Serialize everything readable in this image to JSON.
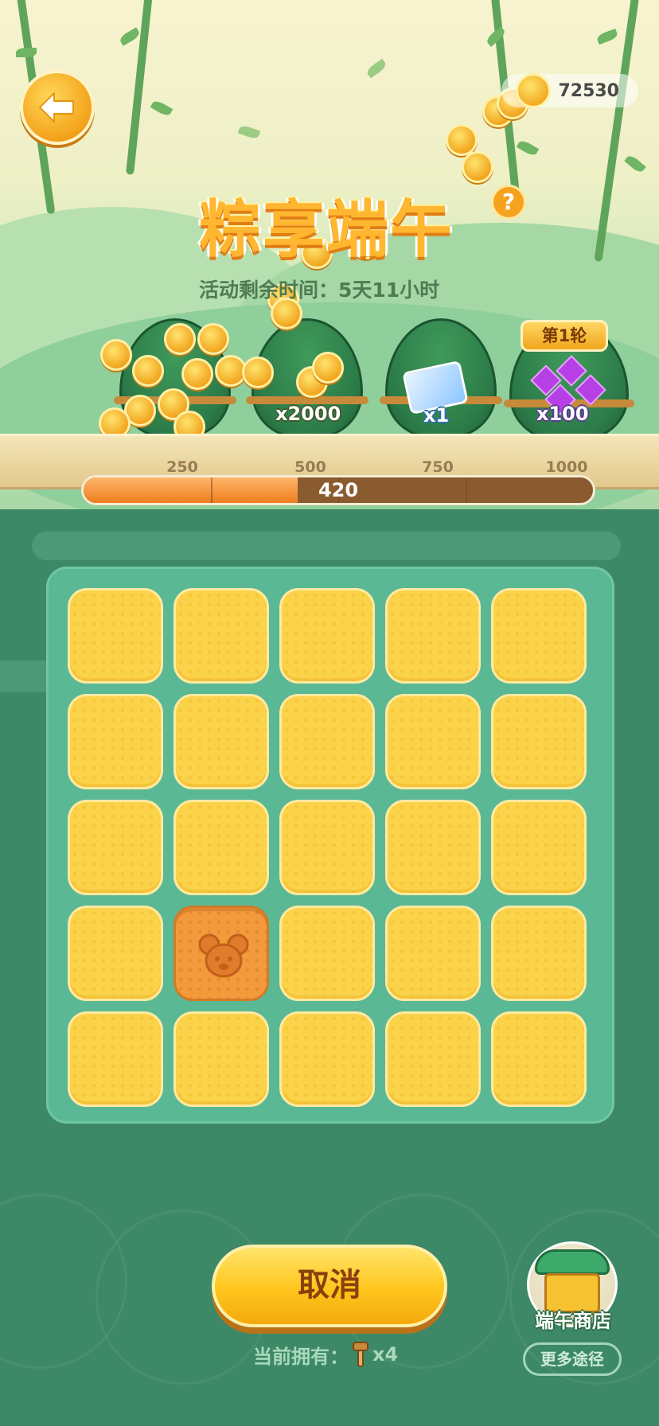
{
  "header": {
    "coin_balance": "72530",
    "event_title": "粽享端午",
    "help_label": "?",
    "time_left_text": "活动剩余时间：5天11小时"
  },
  "rewards": {
    "round_label": "第1轮",
    "items": [
      {
        "icon": "coin-pile",
        "label": ""
      },
      {
        "icon": "coin-stack",
        "label": "x2000"
      },
      {
        "icon": "mickey-card",
        "label": "x1"
      },
      {
        "icon": "purple-gems",
        "label": "x100"
      }
    ]
  },
  "progress": {
    "current": 420,
    "current_label": "420",
    "max": 1000,
    "milestones": [
      "250",
      "500",
      "750",
      "1000"
    ]
  },
  "board": {
    "rows": 5,
    "cols": 5,
    "opened_tiles": [
      {
        "row": 4,
        "col": 2,
        "icon": "mouse-face"
      }
    ]
  },
  "actions": {
    "cancel_label": "取消",
    "owned_prefix": "当前拥有：",
    "owned_count": "x4",
    "owned_icon": "mallet-icon",
    "shop_label": "端午商店",
    "more_label": "更多途径"
  },
  "colors": {
    "tile": "#fbd34a",
    "tile_opened": "#f39a3c",
    "board": "#5bb895",
    "background": "#3d8867",
    "accent": "#ffc51c"
  }
}
